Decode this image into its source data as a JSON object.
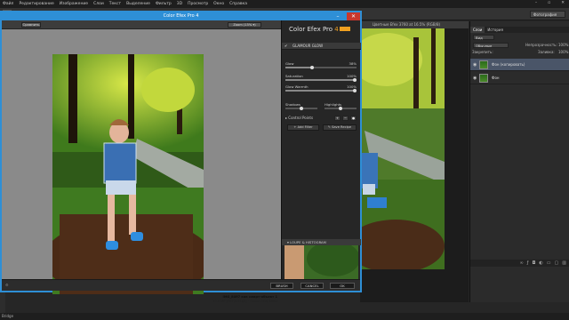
{
  "menubar": {
    "items": [
      "Файл",
      "Редактирование",
      "Изображение",
      "Слои",
      "Текст",
      "Выделение",
      "Фильтр",
      "3D",
      "Просмотр",
      "Окно",
      "Справка"
    ]
  },
  "workspace": {
    "label": "Фотография"
  },
  "ps_document": {
    "tab_title": "Цветные Efex 3760 at 16.5% (RGB/8)"
  },
  "ps_panels": {
    "tabs": [
      "Слои",
      "История"
    ],
    "filter_kind": "Вид",
    "blend_mode": "Обычные",
    "opacity_label": "Непрозрачность:",
    "opacity_value": "100%",
    "lock_label": "Закрепить:",
    "fill_label": "Заливка:",
    "fill_value": "100%",
    "layers": [
      {
        "name": "Фон (копировать)",
        "selected": true
      },
      {
        "name": "Фон",
        "selected": false
      }
    ]
  },
  "statusbar": {
    "text": "Bridge"
  },
  "cefex": {
    "title": "Color Efex Pro 4",
    "compare_label": "Сравнить",
    "zoom_label": "Zoom (15% ▾)",
    "caption_line1": "IMG_8497 как смарт-объект 1",
    "caption_line2": "20.0 MP (3872x5184) · Canon EOS 600D",
    "brand": "Color Efex Pro",
    "version": "4",
    "filter_name": "GLAMOUR GLOW",
    "sliders": [
      {
        "label": "Glow",
        "value": "38%",
        "fraction": 0.38
      },
      {
        "label": "Saturation",
        "value": "100%",
        "fraction": 1.0
      },
      {
        "label": "Glow Warmth",
        "value": "100%",
        "fraction": 1.0
      }
    ],
    "shadows_label": "Shadows",
    "highlights_label": "Highlights",
    "control_points_label": "Control Points",
    "add_filter_label": "Add Filter",
    "save_recipe_label": "Save Recipe",
    "loupe_label": "LOUPE & HISTOGRAM",
    "brush_label": "BRUSH",
    "cancel_label": "CANCEL",
    "ok_label": "OK"
  },
  "colors": {
    "accent": "#2e8fd6",
    "close_red": "#c9372c",
    "brand_orange": "#f0a020"
  }
}
